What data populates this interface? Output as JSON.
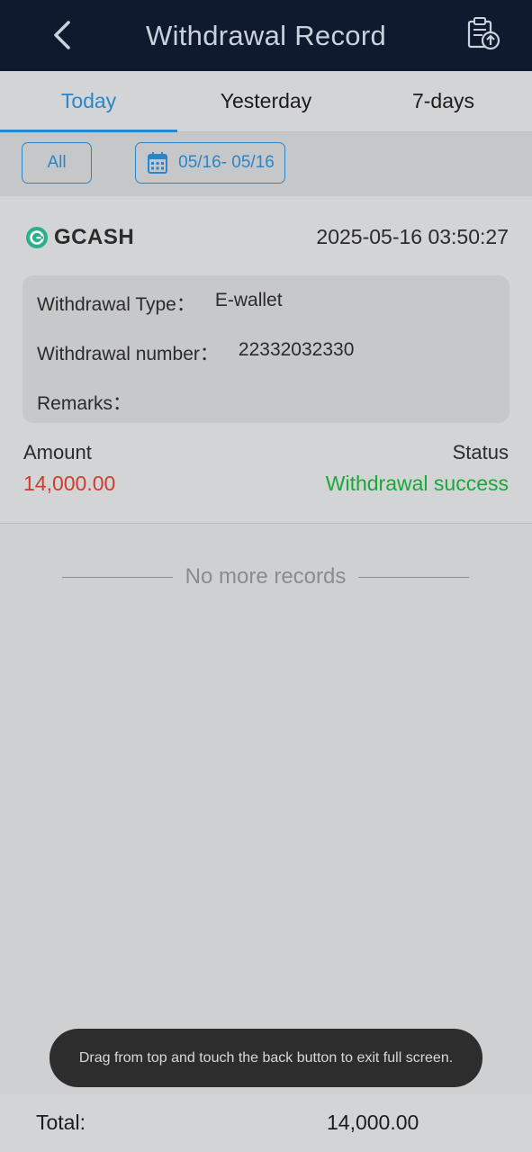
{
  "header": {
    "title": "Withdrawal Record",
    "back_icon": "chevron-left-icon",
    "record_icon": "clipboard-upload-icon"
  },
  "tabs": [
    {
      "label": "Today",
      "active": true
    },
    {
      "label": "Yesterday",
      "active": false
    },
    {
      "label": "7-days",
      "active": false
    }
  ],
  "filters": {
    "all_label": "All",
    "date_range": "05/16- 05/16",
    "date_icon": "calendar-icon"
  },
  "record": {
    "brand": "GCASH",
    "datetime": "2025-05-16 03:50:27",
    "type_label": "Withdrawal Type：",
    "type_value": "E-wallet",
    "number_label": "Withdrawal number：",
    "number_value": "22332032330",
    "remarks_label": "Remarks：",
    "amount_label": "Amount",
    "amount_value": "14,000.00",
    "status_label": "Status",
    "status_value": "Withdrawal success"
  },
  "list_end": "No more records",
  "toast": "Drag from top and touch the back button to exit full screen.",
  "footer": {
    "total_label": "Total:",
    "total_value": "14,000.00"
  },
  "colors": {
    "accent": "#2a86c9",
    "amount": "#d23b2a",
    "success": "#19a83a",
    "header_bg": "#0f1a2e"
  }
}
